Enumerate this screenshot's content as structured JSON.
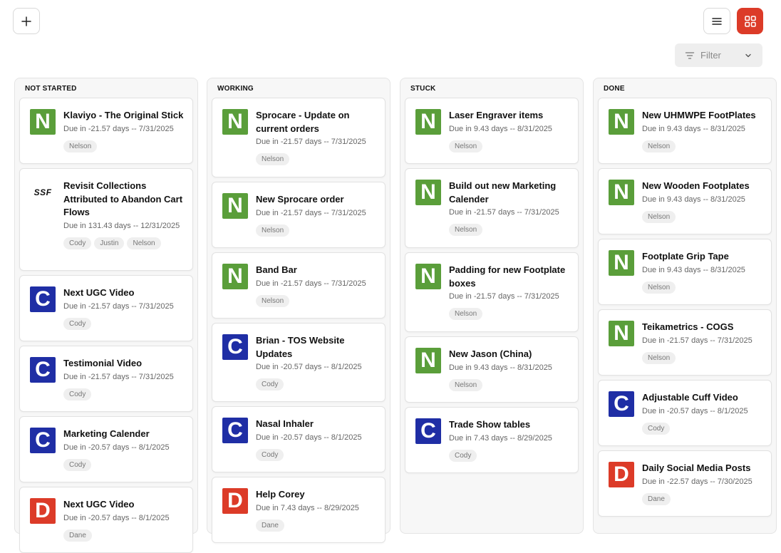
{
  "toolbar": {
    "add_icon": "plus-icon",
    "list_icon": "list-icon",
    "grid_icon": "grid-icon",
    "accent": "#dc3b28",
    "filter_label": "Filter"
  },
  "colors": {
    "N": "#5a9e3a",
    "C": "#1f2ea5",
    "D": "#dc3b28"
  },
  "columns": [
    {
      "title": "NOT STARTED",
      "cards": [
        {
          "avatar": "N",
          "title": "Klaviyo - The Original Stick",
          "due": "Due in -21.57 days -- 7/31/2025",
          "tags": [
            "Nelson"
          ]
        },
        {
          "avatar": "SSF",
          "title": "Revisit Collections Attributed to Abandon Cart Flows",
          "due": "Due in 131.43 days -- 12/31/2025",
          "tags": [
            "Cody",
            "Justin",
            "Nelson"
          ]
        },
        {
          "avatar": "C",
          "title": "Next UGC Video",
          "due": "Due in -21.57 days -- 7/31/2025",
          "tags": [
            "Cody"
          ]
        },
        {
          "avatar": "C",
          "title": "Testimonial Video",
          "due": "Due in -21.57 days -- 7/31/2025",
          "tags": [
            "Cody"
          ]
        },
        {
          "avatar": "C",
          "title": "Marketing Calender",
          "due": "Due in -20.57 days -- 8/1/2025",
          "tags": [
            "Cody"
          ]
        },
        {
          "avatar": "D",
          "title": "Next UGC Video",
          "due": "Due in -20.57 days -- 8/1/2025",
          "tags": [
            "Dane"
          ]
        }
      ]
    },
    {
      "title": "WORKING",
      "cards": [
        {
          "avatar": "N",
          "title": "Sprocare - Update on current orders",
          "due": "Due in -21.57 days -- 7/31/2025",
          "tags": [
            "Nelson"
          ]
        },
        {
          "avatar": "N",
          "title": "New Sprocare order",
          "due": "Due in -21.57 days -- 7/31/2025",
          "tags": [
            "Nelson"
          ]
        },
        {
          "avatar": "N",
          "title": "Band Bar",
          "due": "Due in -21.57 days -- 7/31/2025",
          "tags": [
            "Nelson"
          ]
        },
        {
          "avatar": "C",
          "title": "Brian - TOS Website Updates",
          "due": "Due in -20.57 days -- 8/1/2025",
          "tags": [
            "Cody"
          ]
        },
        {
          "avatar": "C",
          "title": "Nasal Inhaler",
          "due": "Due in -20.57 days -- 8/1/2025",
          "tags": [
            "Cody"
          ]
        },
        {
          "avatar": "D",
          "title": "Help Corey",
          "due": "Due in 7.43 days -- 8/29/2025",
          "tags": [
            "Dane"
          ]
        }
      ]
    },
    {
      "title": "STUCK",
      "cards": [
        {
          "avatar": "N",
          "title": "Laser Engraver items",
          "due": "Due in 9.43 days -- 8/31/2025",
          "tags": [
            "Nelson"
          ]
        },
        {
          "avatar": "N",
          "title": "Build out new Marketing Calender",
          "due": "Due in -21.57 days -- 7/31/2025",
          "tags": [
            "Nelson"
          ]
        },
        {
          "avatar": "N",
          "title": "Padding for new Footplate boxes",
          "due": "Due in -21.57 days -- 7/31/2025",
          "tags": [
            "Nelson"
          ]
        },
        {
          "avatar": "N",
          "title": "New Jason (China)",
          "due": "Due in 9.43 days -- 8/31/2025",
          "tags": [
            "Nelson"
          ]
        },
        {
          "avatar": "C",
          "title": "Trade Show tables",
          "due": "Due in 7.43 days -- 8/29/2025",
          "tags": [
            "Cody"
          ]
        }
      ]
    },
    {
      "title": "DONE",
      "cards": [
        {
          "avatar": "N",
          "title": "New UHMWPE FootPlates",
          "due": "Due in 9.43 days -- 8/31/2025",
          "tags": [
            "Nelson"
          ]
        },
        {
          "avatar": "N",
          "title": "New Wooden Footplates",
          "due": "Due in 9.43 days -- 8/31/2025",
          "tags": [
            "Nelson"
          ]
        },
        {
          "avatar": "N",
          "title": "Footplate Grip Tape",
          "due": "Due in 9.43 days -- 8/31/2025",
          "tags": [
            "Nelson"
          ]
        },
        {
          "avatar": "N",
          "title": "Teikametrics - COGS",
          "due": "Due in -21.57 days -- 7/31/2025",
          "tags": [
            "Nelson"
          ]
        },
        {
          "avatar": "C",
          "title": "Adjustable Cuff Video",
          "due": "Due in -20.57 days -- 8/1/2025",
          "tags": [
            "Cody"
          ]
        },
        {
          "avatar": "D",
          "title": "Daily Social Media Posts",
          "due": "Due in -22.57 days -- 7/30/2025",
          "tags": [
            "Dane"
          ]
        }
      ]
    }
  ]
}
